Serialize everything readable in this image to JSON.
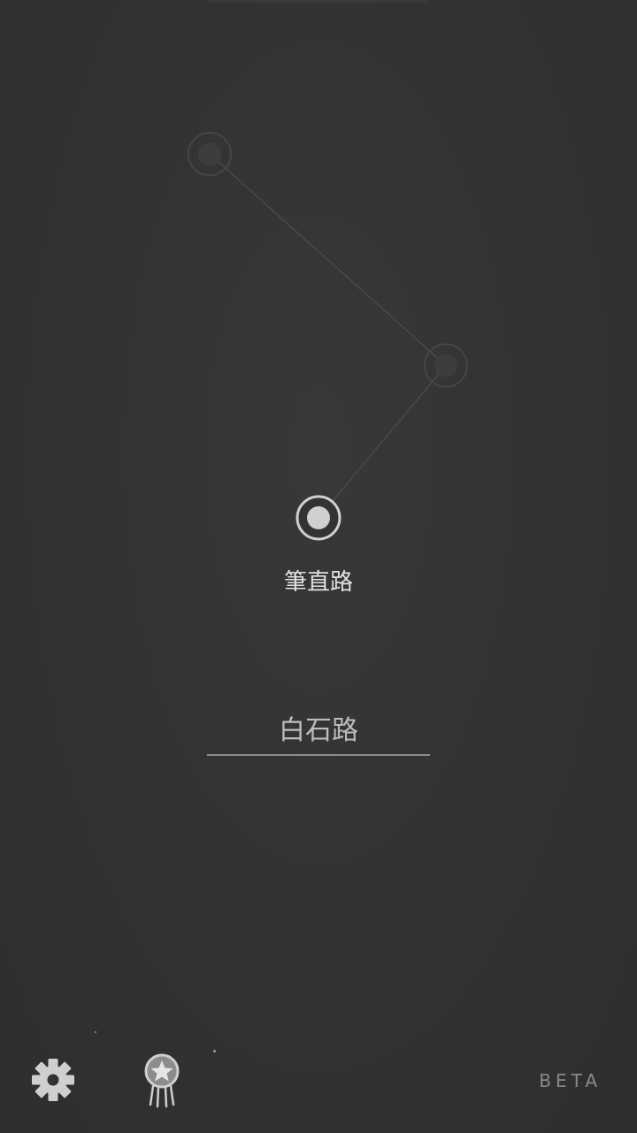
{
  "route": {
    "current_station": "筆直路"
  },
  "answer_input": {
    "placeholder": "白石路",
    "value": ""
  },
  "toolbar": {
    "settings_icon": "gear-icon",
    "award_icon": "medal-star-icon",
    "beta_label": "BETA"
  },
  "colors": {
    "background": "#333333",
    "visited_node": "#3d3d3d",
    "current_node": "#d0d0d0",
    "path_line": "#4a4a4a",
    "label_text": "#e2e2e2",
    "beta_text": "#8a8a8a"
  }
}
